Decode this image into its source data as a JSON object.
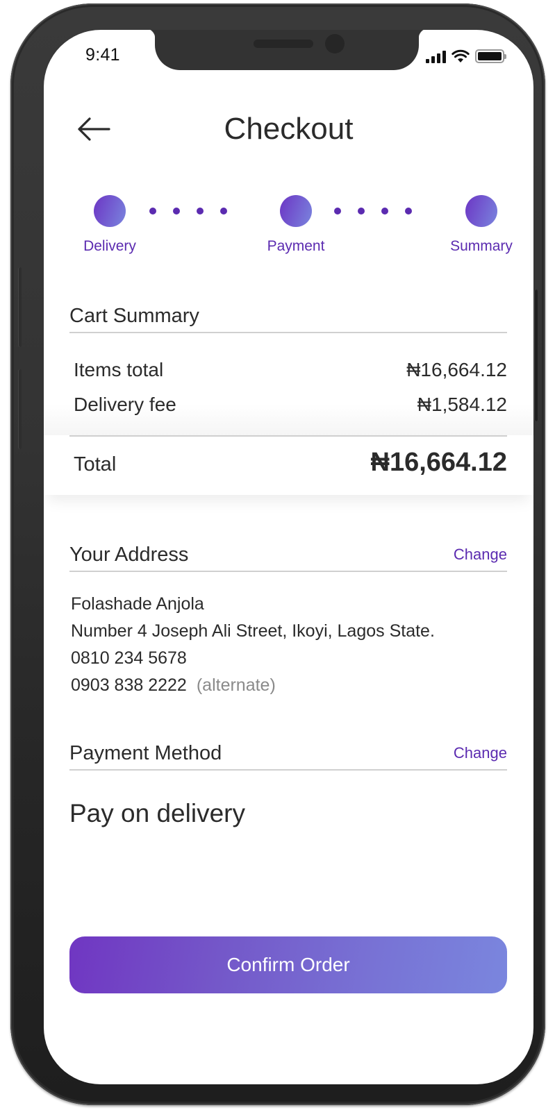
{
  "status_bar": {
    "time": "9:41",
    "icons": [
      "cellular-signal-icon",
      "wifi-icon",
      "battery-icon"
    ]
  },
  "header": {
    "back_icon": "arrow-left-icon",
    "title": "Checkout"
  },
  "stepper": {
    "steps": [
      {
        "label": "Delivery"
      },
      {
        "label": "Payment"
      },
      {
        "label": "Summary"
      }
    ],
    "accent_color": "#5b2bb0"
  },
  "cart_summary": {
    "title": "Cart Summary",
    "rows": [
      {
        "label": "Items total",
        "amount": "₦16,664.12"
      },
      {
        "label": "Delivery fee",
        "amount": "₦1,584.12"
      }
    ],
    "total_label": "Total",
    "total_amount": "₦16,664.12"
  },
  "address": {
    "title": "Your Address",
    "change_label": "Change",
    "name": "Folashade Anjola",
    "street": "Number 4 Joseph Ali Street, Ikoyi, Lagos State.",
    "phone_primary": "0810 234 5678",
    "phone_alternate": "0903 838 2222",
    "alternate_note": "(alternate)"
  },
  "payment_method": {
    "title": "Payment Method",
    "change_label": "Change",
    "value": "Pay on delivery"
  },
  "actions": {
    "confirm_label": "Confirm Order",
    "gradient_start": "#7036c2",
    "gradient_end": "#7a86de"
  }
}
